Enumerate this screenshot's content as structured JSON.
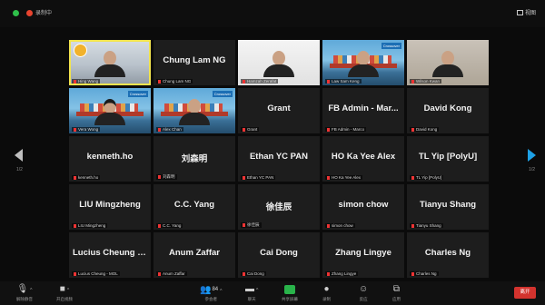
{
  "topbar": {
    "recording_text": "录制中",
    "view_label": "视图"
  },
  "nav": {
    "page_left": "1/2",
    "page_right": "1/2"
  },
  "tiles": [
    {
      "type": "video",
      "scene": "office",
      "caption": "Hing Wang",
      "active": true,
      "logo": true
    },
    {
      "type": "name",
      "name": "Chung Lam NG",
      "caption": "Chung Lam NG"
    },
    {
      "type": "video",
      "scene": "white",
      "caption": "Hamzah Zerafat"
    },
    {
      "type": "video",
      "scene": "ship",
      "caption": "Law Sam Keng",
      "banner": "Crossover"
    },
    {
      "type": "video",
      "scene": "room",
      "caption": "Wilson Kwan"
    },
    {
      "type": "video",
      "scene": "ship",
      "caption": "Vera Wong",
      "banner": "Crossover",
      "hair": true
    },
    {
      "type": "video",
      "scene": "ship",
      "caption": "Alex Chan",
      "banner": "Crossover"
    },
    {
      "type": "name",
      "name": "Grant",
      "caption": "Grant"
    },
    {
      "type": "name",
      "name": "FB Admin - Mar...",
      "caption": "FB Admin - Marco"
    },
    {
      "type": "name",
      "name": "David Kong",
      "caption": "David Kong"
    },
    {
      "type": "name",
      "name": "kenneth.ho",
      "caption": "kenneth.ho"
    },
    {
      "type": "name",
      "name": "刘森明",
      "caption": "刘森明"
    },
    {
      "type": "name",
      "name": "Ethan YC PAN",
      "caption": "Ethan YC PAN"
    },
    {
      "type": "name",
      "name": "HO Ka Yee Alex",
      "caption": "HO Ka Yee Alex"
    },
    {
      "type": "name",
      "name": "TL Yip [PolyU]",
      "caption": "TL Yip [PolyU]"
    },
    {
      "type": "name",
      "name": "LIU Mingzheng",
      "caption": "LIU Mingzheng"
    },
    {
      "type": "name",
      "name": "C.C. Yang",
      "caption": "C.C. Yang"
    },
    {
      "type": "name",
      "name": "徐佳辰",
      "caption": "徐佳辰"
    },
    {
      "type": "name",
      "name": "simon chow",
      "caption": "simon chow"
    },
    {
      "type": "name",
      "name": "Tianyu Shang",
      "caption": "Tianyu Shang"
    },
    {
      "type": "name",
      "name": "Lucius Cheung -...",
      "caption": "Lucius Cheung - MOL"
    },
    {
      "type": "name",
      "name": "Anum Zaffar",
      "caption": "Anum Zaffar"
    },
    {
      "type": "name",
      "name": "Cai Dong",
      "caption": "Cai Dong"
    },
    {
      "type": "name",
      "name": "Zhang Lingye",
      "caption": "Zhang Lingye"
    },
    {
      "type": "name",
      "name": "Charles Ng",
      "caption": "Charles Ng"
    }
  ],
  "toolbar": {
    "mute_label": "解除静音",
    "video_label": "开启视频",
    "participants_label": "参会者",
    "participants_count": "84",
    "chat_label": "聊天",
    "share_label": "共享屏幕",
    "record_label": "录制",
    "reactions_label": "反应",
    "apps_label": "应用",
    "end_label": "离开"
  }
}
